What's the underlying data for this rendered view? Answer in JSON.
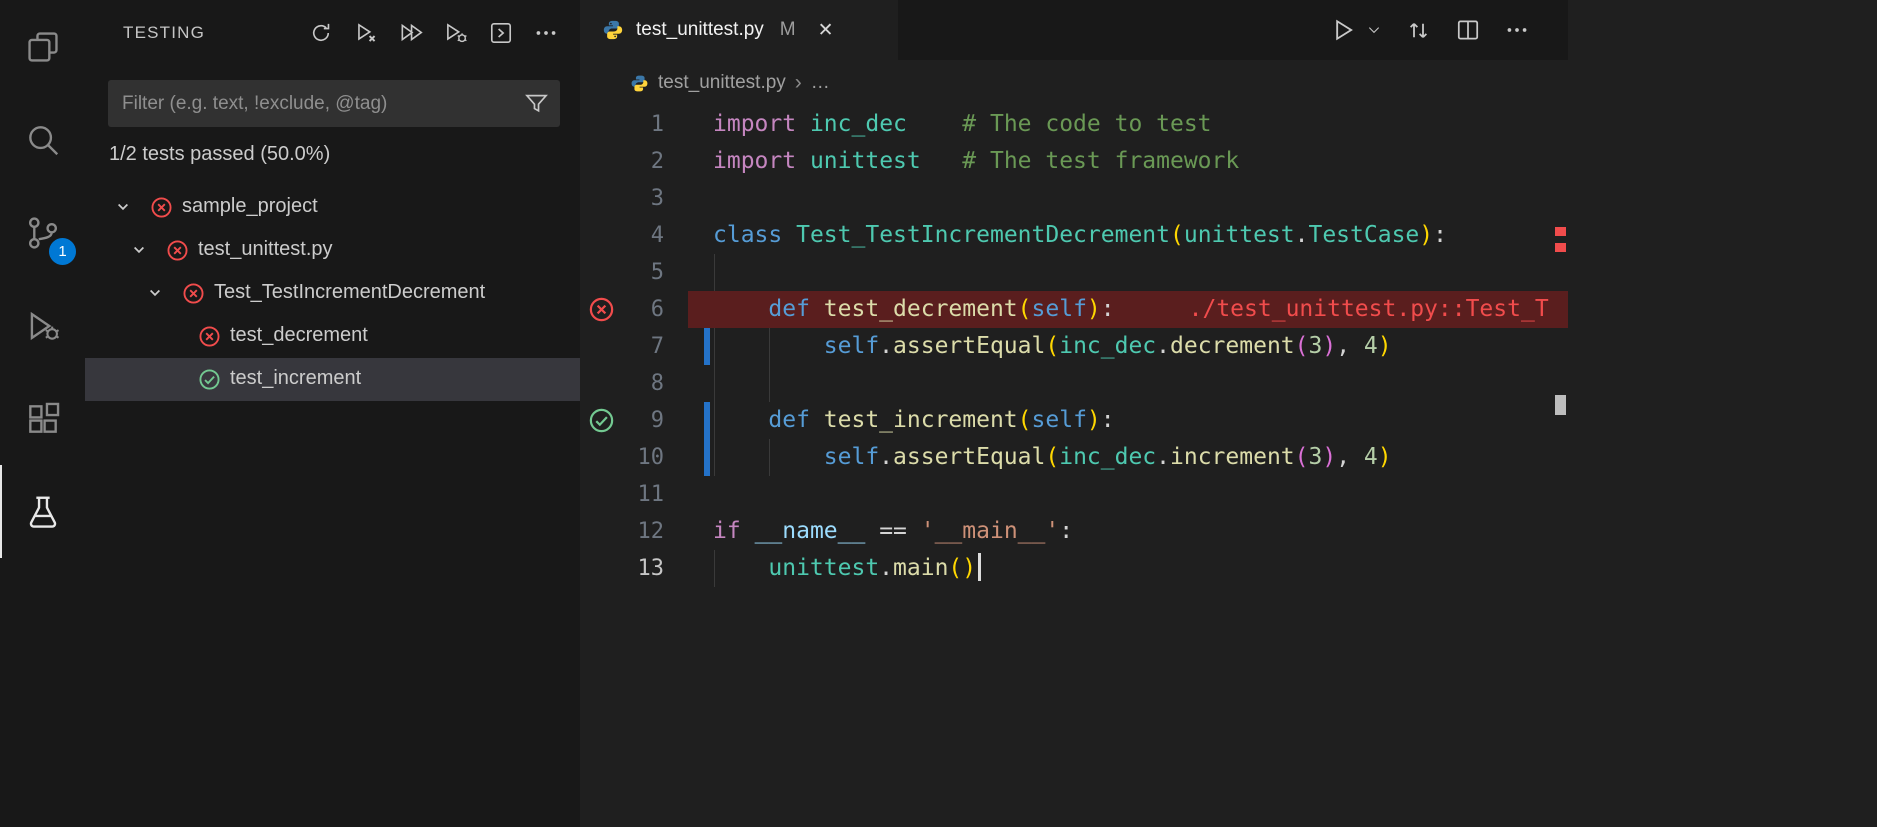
{
  "activity_bar": {
    "items": [
      {
        "id": "explorer"
      },
      {
        "id": "search"
      },
      {
        "id": "source-control",
        "badge": "1"
      },
      {
        "id": "run-debug"
      },
      {
        "id": "extensions"
      },
      {
        "id": "testing",
        "active": true
      }
    ]
  },
  "sidebar": {
    "title": "TESTING",
    "toolbar": [
      {
        "id": "refresh-tests"
      },
      {
        "id": "rerun-failed-tests"
      },
      {
        "id": "run-all-tests"
      },
      {
        "id": "debug-tests"
      },
      {
        "id": "goto-test"
      },
      {
        "id": "more-actions"
      }
    ],
    "filter_placeholder": "Filter (e.g. text, !exclude, @tag)",
    "status": "1/2 tests passed (50.0%)",
    "tree": [
      {
        "label": "sample_project",
        "depth": 0,
        "state": "fail",
        "expandable": true
      },
      {
        "label": "test_unittest.py",
        "depth": 1,
        "state": "fail",
        "expandable": true
      },
      {
        "label": "Test_TestIncrementDecrement",
        "depth": 2,
        "state": "fail",
        "expandable": true
      },
      {
        "label": "test_decrement",
        "depth": 3,
        "state": "fail"
      },
      {
        "label": "test_increment",
        "depth": 3,
        "state": "pass",
        "selected": true
      }
    ]
  },
  "editor": {
    "tab": {
      "title": "test_unittest.py",
      "modified": "M",
      "close": "✕"
    },
    "breadcrumb": {
      "file": "test_unittest.py",
      "separator": "›",
      "more": "…"
    },
    "code": {
      "lines": [
        {
          "n": 1,
          "tokens": [
            [
              "kw",
              "import"
            ],
            [
              "pun",
              " "
            ],
            [
              "type",
              "inc_dec"
            ],
            [
              "pun",
              "    "
            ],
            [
              "com",
              "# The code to test"
            ]
          ]
        },
        {
          "n": 2,
          "tokens": [
            [
              "kw",
              "import"
            ],
            [
              "pun",
              " "
            ],
            [
              "type",
              "unittest"
            ],
            [
              "pun",
              "   "
            ],
            [
              "com",
              "# The test framework"
            ]
          ]
        },
        {
          "n": 3,
          "tokens": []
        },
        {
          "n": 4,
          "tokens": [
            [
              "blue",
              "class"
            ],
            [
              "pun",
              " "
            ],
            [
              "type",
              "Test_TestIncrementDecrement"
            ],
            [
              "b1",
              "("
            ],
            [
              "type",
              "unittest"
            ],
            [
              "pun",
              "."
            ],
            [
              "type",
              "TestCase"
            ],
            [
              "b1",
              ")"
            ],
            [
              "pun",
              ":"
            ]
          ]
        },
        {
          "n": 5,
          "tokens": []
        },
        {
          "n": 6,
          "state": "fail",
          "inline_error": "./test_unittest.py::Test_T",
          "tokens": [
            [
              "pun",
              "    "
            ],
            [
              "blue",
              "def"
            ],
            [
              "pun",
              " "
            ],
            [
              "fn",
              "test_decrement"
            ],
            [
              "b1",
              "("
            ],
            [
              "blue",
              "self"
            ],
            [
              "b1",
              ")"
            ],
            [
              "pun",
              ":"
            ]
          ]
        },
        {
          "n": 7,
          "modified": true,
          "tokens": [
            [
              "pun",
              "        "
            ],
            [
              "blue",
              "self"
            ],
            [
              "pun",
              "."
            ],
            [
              "fn",
              "assertEqual"
            ],
            [
              "b1",
              "("
            ],
            [
              "type",
              "inc_dec"
            ],
            [
              "pun",
              "."
            ],
            [
              "fn",
              "decrement"
            ],
            [
              "b2",
              "("
            ],
            [
              "num",
              "3"
            ],
            [
              "b2",
              ")"
            ],
            [
              "pun",
              ", "
            ],
            [
              "num",
              "4"
            ],
            [
              "b1",
              ")"
            ]
          ]
        },
        {
          "n": 8,
          "tokens": []
        },
        {
          "n": 9,
          "state": "pass",
          "modified": true,
          "tokens": [
            [
              "pun",
              "    "
            ],
            [
              "blue",
              "def"
            ],
            [
              "pun",
              " "
            ],
            [
              "fn",
              "test_increment"
            ],
            [
              "b1",
              "("
            ],
            [
              "blue",
              "self"
            ],
            [
              "b1",
              ")"
            ],
            [
              "pun",
              ":"
            ]
          ]
        },
        {
          "n": 10,
          "modified": true,
          "tokens": [
            [
              "pun",
              "        "
            ],
            [
              "blue",
              "self"
            ],
            [
              "pun",
              "."
            ],
            [
              "fn",
              "assertEqual"
            ],
            [
              "b1",
              "("
            ],
            [
              "type",
              "inc_dec"
            ],
            [
              "pun",
              "."
            ],
            [
              "fn",
              "increment"
            ],
            [
              "b2",
              "("
            ],
            [
              "num",
              "3"
            ],
            [
              "b2",
              ")"
            ],
            [
              "pun",
              ", "
            ],
            [
              "num",
              "4"
            ],
            [
              "b1",
              ")"
            ]
          ]
        },
        {
          "n": 11,
          "tokens": []
        },
        {
          "n": 12,
          "tokens": [
            [
              "kw",
              "if"
            ],
            [
              "pun",
              " "
            ],
            [
              "var",
              "__name__"
            ],
            [
              "pun",
              " == "
            ],
            [
              "str",
              "'__main__'"
            ],
            [
              "pun",
              ":"
            ]
          ]
        },
        {
          "n": 13,
          "active": true,
          "cursor": true,
          "tokens": [
            [
              "pun",
              "    "
            ],
            [
              "type",
              "unittest"
            ],
            [
              "pun",
              "."
            ],
            [
              "fn",
              "main"
            ],
            [
              "b1",
              "()"
            ]
          ]
        }
      ]
    }
  },
  "colors": {
    "kw": "#C586C0",
    "blue": "#569CD6",
    "type": "#4EC9B0",
    "fn": "#DCDCAA",
    "com": "#6A9955",
    "str": "#CE9178",
    "num": "#B5CEA8",
    "pun": "#D4D4D4",
    "b1": "#FFD700",
    "b2": "#DA70D6",
    "var": "#9CDCFE",
    "fail": "#F14C4C",
    "pass": "#73C991",
    "error_line_bg": "#5A1E1E",
    "modified_bar": "#2472C8",
    "badge_bg": "#0078D4"
  }
}
